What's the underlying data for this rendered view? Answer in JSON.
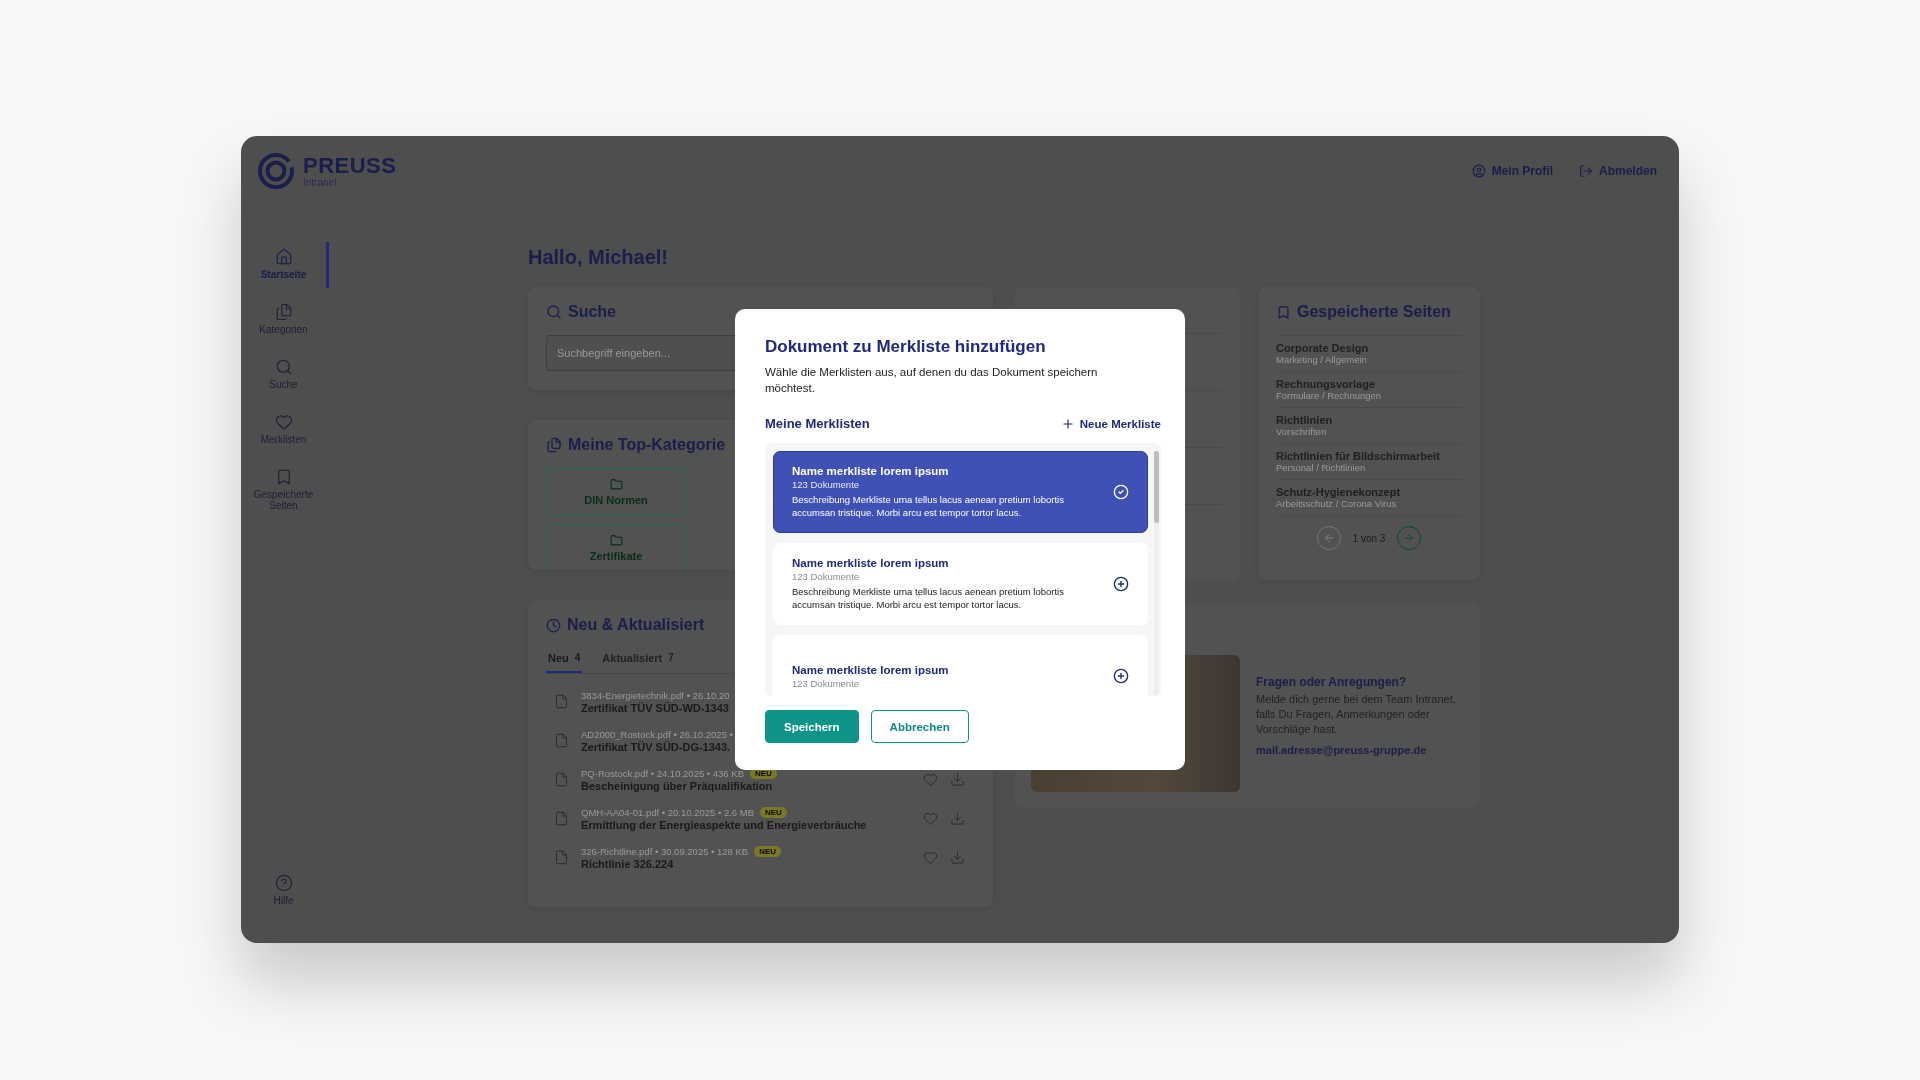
{
  "header": {
    "logo_title": "PREUSS",
    "logo_subtitle": "Intranet",
    "links": [
      {
        "label": "Mein Profil",
        "kind": "profile"
      },
      {
        "label": "Abmelden",
        "kind": "logout"
      }
    ]
  },
  "sidebar": {
    "items": [
      {
        "label": "Startseite",
        "selected": true
      },
      {
        "label": "Kategorien",
        "selected": false
      },
      {
        "label": "Suche",
        "selected": false
      },
      {
        "label": "Merklisten",
        "selected": false
      },
      {
        "label": "Gespeicherte Seiten",
        "selected": false
      }
    ],
    "help": {
      "label": "Hilfe"
    }
  },
  "greeting": "Hallo, Michael!",
  "search_card": {
    "title": "Suche",
    "placeholder": "Suchbegriff eingeben..."
  },
  "top_categories": {
    "title": "Meine Top-Kategorie",
    "items": [
      {
        "label": "DIN Normen"
      },
      {
        "label": "Zertifikate"
      }
    ]
  },
  "news": {
    "title": "Neu & Aktualisiert",
    "tabs": [
      {
        "label": "Neu",
        "count": "4",
        "selected": true
      },
      {
        "label": "Aktualisiert",
        "count": "7",
        "selected": false
      }
    ],
    "rows": [
      {
        "kind": "partial",
        "meta": "3834-Energietechnik.pdf • 26.10.20",
        "title": "Zertifikat TÜV SÜD-WD-1343"
      },
      {
        "kind": "partial",
        "meta": "AD2000_Rostock.pdf • 26.10.2025 •",
        "title": "Zertifikat TÜV SÜD-DG-1343."
      },
      {
        "kind": "full",
        "meta": "PQ-Rostock.pdf • 24.10.2025 • 436 KB",
        "badge": "NEU",
        "title": "Bescheinigung über Präqualifikation"
      },
      {
        "kind": "full",
        "meta": "QMH-AA04-01.pdf • 20.10.2025 • 2.6 MB",
        "badge": "NEU",
        "title": "Ermittlung der Energieaspekte und Energieverbräuche"
      },
      {
        "kind": "full",
        "meta": "326-Richtline.pdf • 30.09.2025 • 128 KB",
        "badge": "NEU",
        "title": "Richtlinie 326.224"
      }
    ]
  },
  "saved_pages": {
    "title": "Gespeicherte Seiten",
    "items": [
      {
        "title": "Corporate Design",
        "path": "Marketing / Allgemein"
      },
      {
        "title": "Rechnungsvorlage",
        "path": "Formulare / Rechnungen"
      },
      {
        "title": "Richtlinien",
        "path": "Vorschriften"
      },
      {
        "title": "Richtlinien für Bildschirmarbeit",
        "path": "Personal / Richtlinien"
      },
      {
        "title": "Schutz-Hygienekonzept",
        "path": "Arbeitsschutz / Corona Virus"
      }
    ],
    "pagination": {
      "label": "1 von 3",
      "prev_disabled": true,
      "next_disabled": false
    }
  },
  "contact": {
    "title": "Fragen oder Anregungen?",
    "text": "Melde dich gerne bei dem Team Intranet, falls Du Fragen, Anmerkungen oder Vorschläge hast.",
    "email": "mail.adresse@preuss-gruppe.de"
  },
  "modal": {
    "title": "Dokument zu Merkliste hinzufügen",
    "description": "Wähle die Merklisten aus, auf denen du das Dokument speichern möchtest.",
    "section_label": "Meine Merklisten",
    "new_button": "Neue Merkliste",
    "lists": [
      {
        "name": "Name merkliste lorem ipsum",
        "count": "123 Dokumente",
        "description": "Beschreibung Merkliste urna tellus lacus aenean pretium lobortis accumsan tristique. Morbi arcu est tempor tortor lacus.",
        "selected": true
      },
      {
        "name": "Name merkliste lorem ipsum",
        "count": "123 Dokumente",
        "description": "Beschreibung Merkliste urna tellus lacus aenean pretium lobortis accumsan tristique. Morbi arcu est tempor tortor lacus.",
        "selected": false
      },
      {
        "name": "Name merkliste lorem ipsum",
        "count": "123 Dokumente",
        "selected": false
      }
    ],
    "buttons": [
      {
        "label": "Speichern",
        "kind": "primary"
      },
      {
        "label": "Abbrechen",
        "kind": "secondary"
      }
    ]
  }
}
